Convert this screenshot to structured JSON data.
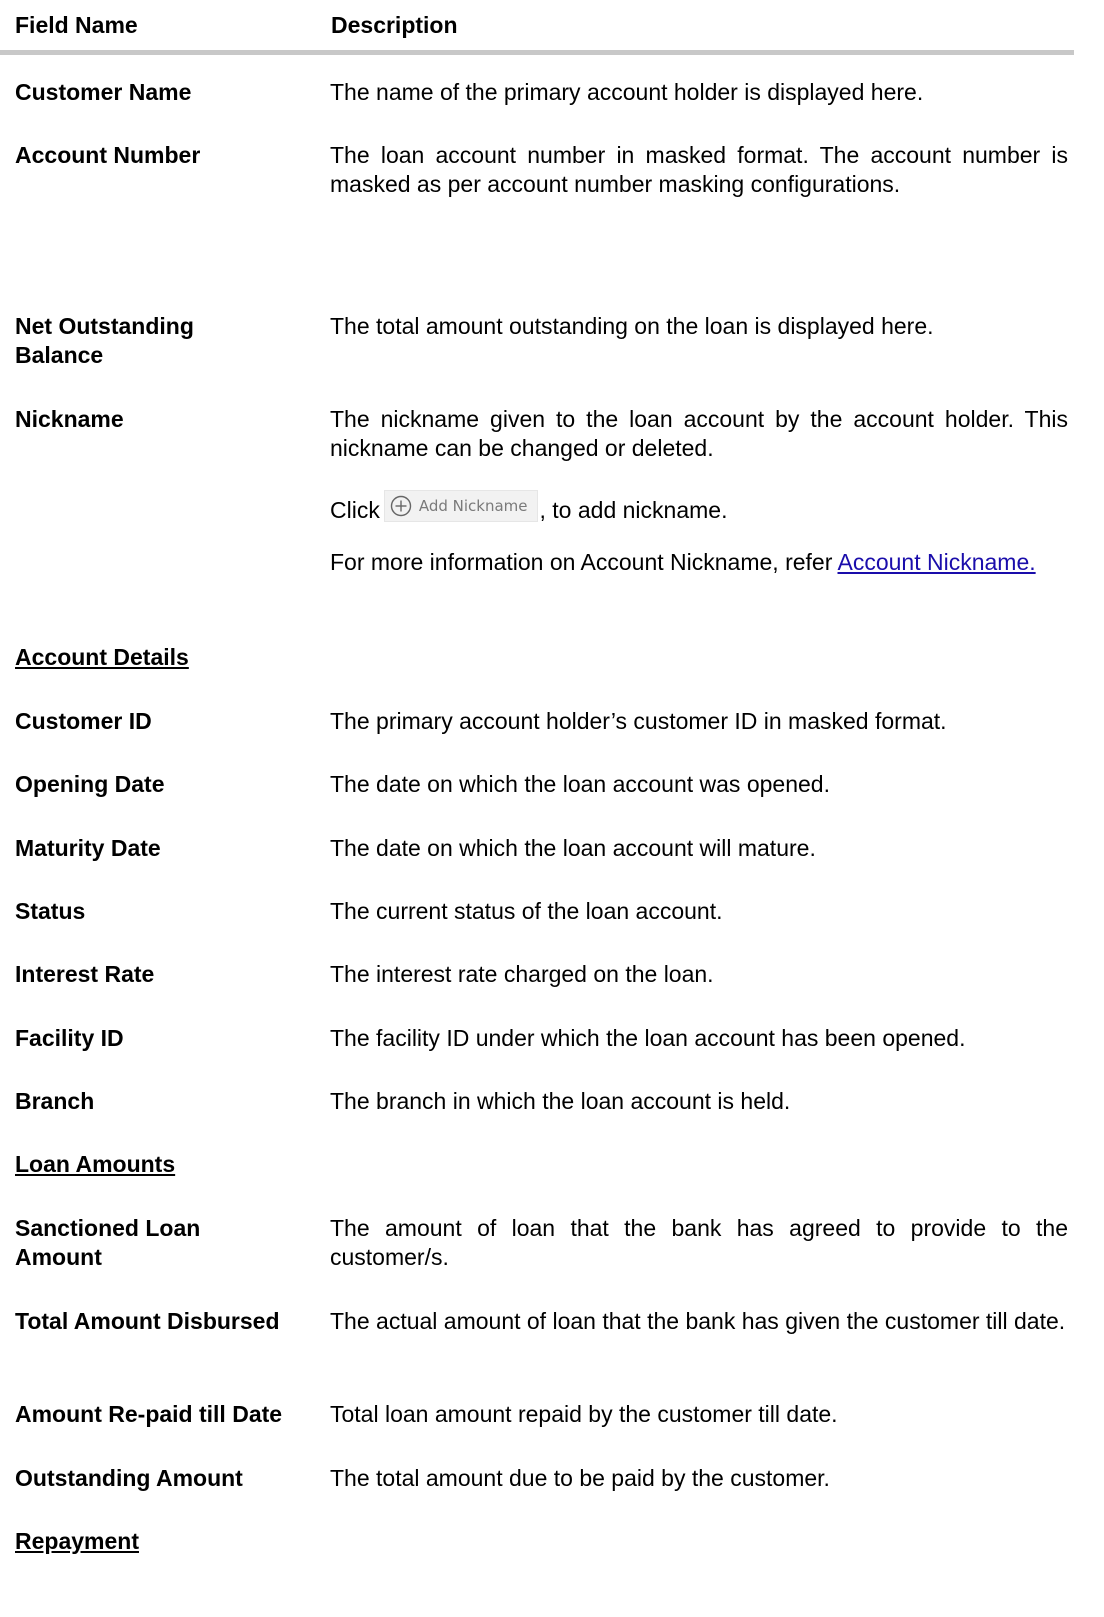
{
  "header": {
    "col1": "Field Name",
    "col2": "Description"
  },
  "rows1": [
    {
      "name": "Customer Name",
      "desc": "The name of the primary account holder is displayed here."
    },
    {
      "name": "Account Number",
      "desc": "The loan account number in masked format. The account number is masked as per account number masking configurations."
    },
    {
      "name": "Net Outstanding Balance",
      "desc": "The total amount outstanding on the loan is displayed here."
    },
    {
      "name": "Nickname",
      "desc": "The nickname given to the loan account by the account holder. This nickname can be changed or deleted."
    }
  ],
  "nickname_click": {
    "before": "Click",
    "button_label": "Add Nickname",
    "after": ", to add nickname."
  },
  "nickname_more": {
    "text": "For more information on Account Nickname, refer ",
    "link": "Account Nickname."
  },
  "section_account_details": "Account Details",
  "rows2": [
    {
      "name": "Customer ID",
      "desc": "The primary account holder’s customer ID in masked format."
    },
    {
      "name": "Opening Date",
      "desc": "The date on which the loan account was opened."
    },
    {
      "name": "Maturity Date",
      "desc": "The date on which the loan account will mature."
    },
    {
      "name": "Status",
      "desc": "The current status of the loan account."
    },
    {
      "name": "Interest Rate",
      "desc": "The interest rate charged on the loan."
    },
    {
      "name": "Facility ID",
      "desc": "The facility ID under which the loan account has been opened."
    },
    {
      "name": "Branch",
      "desc": "The branch in which the loan account is held."
    }
  ],
  "section_loan_amounts": "Loan Amounts",
  "rows3": [
    {
      "name": "Sanctioned Loan Amount",
      "desc": "The amount of loan that the bank has agreed to provide to the customer/s."
    },
    {
      "name": "Total Amount Disbursed",
      "desc": "The actual amount of loan that the bank has given the customer till date."
    },
    {
      "name": "Amount Re-paid till Date",
      "desc": "Total loan amount repaid by the customer till date."
    },
    {
      "name": "Outstanding Amount",
      "desc": "The total amount due to be paid by the customer."
    }
  ],
  "section_repayment": "Repayment"
}
